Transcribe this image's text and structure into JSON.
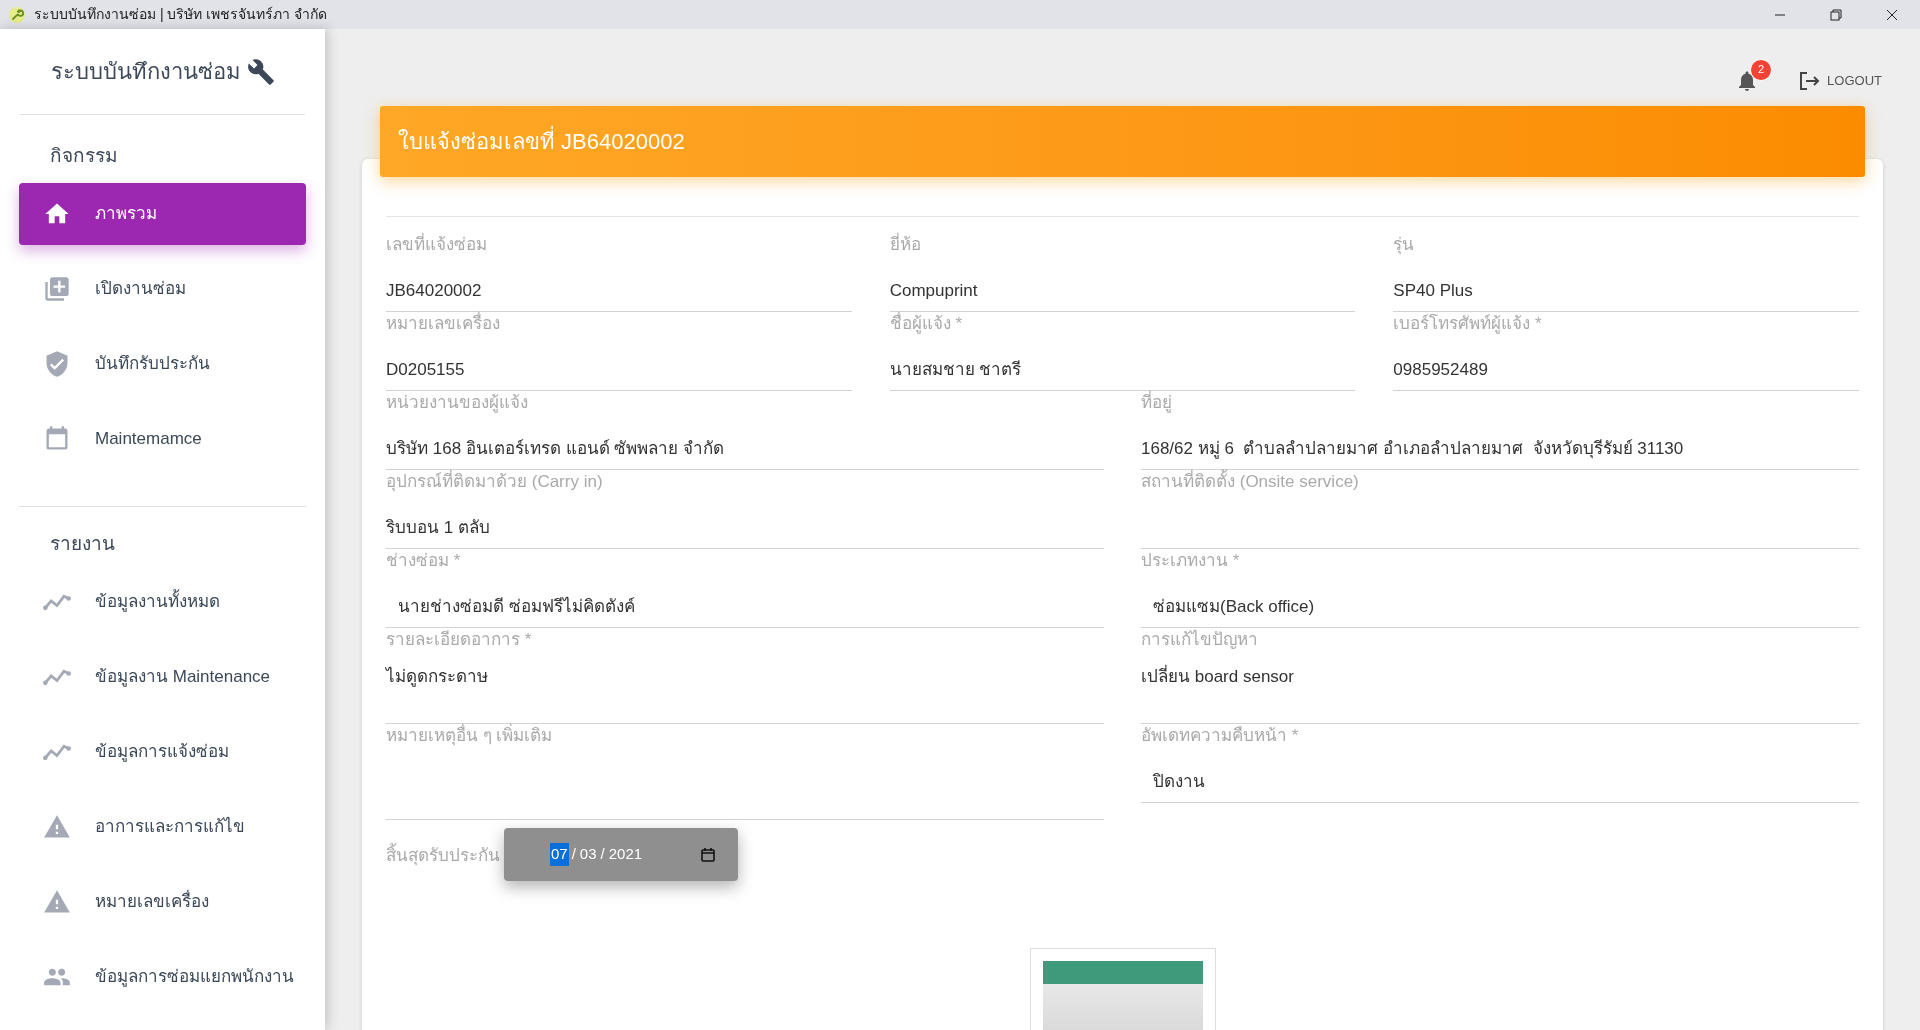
{
  "window": {
    "title": "ระบบบันทึกงานซ่อม | บริษัท เพชรจันทร์ภา จำกัด"
  },
  "sidebar": {
    "title": "ระบบบันทึกงานซ่อม",
    "sections": [
      {
        "heading": "กิจกรรม",
        "items": [
          {
            "label": "ภาพรวม",
            "selected": true
          },
          {
            "label": "เปิดงานซ่อม",
            "selected": false
          },
          {
            "label": "บันทึกรับประกัน",
            "selected": false
          },
          {
            "label": "Maintemamce",
            "selected": false
          }
        ]
      },
      {
        "heading": "รายงาน",
        "items": [
          {
            "label": "ข้อมูลงานทั้งหมด",
            "selected": false
          },
          {
            "label": "ข้อมูลงาน Maintenance",
            "selected": false
          },
          {
            "label": "ข้อมูลการแจ้งซ่อม",
            "selected": false
          },
          {
            "label": "อาการและการแก้ไข",
            "selected": false
          },
          {
            "label": "หมายเลขเครื่อง",
            "selected": false
          },
          {
            "label": "ข้อมูลการซ่อมแยกพนักงาน",
            "selected": false
          }
        ]
      }
    ]
  },
  "topbar": {
    "notification_count": "2",
    "logout": "LOGOUT"
  },
  "form": {
    "title": "ใบแจ้งซ่อมเลขที่ JB64020002",
    "rows": [
      {
        "fields": [
          {
            "label": "เลขที่แจ้งซ่อม",
            "value": "JB64020002",
            "kind": "text"
          },
          {
            "label": "ยี่ห้อ",
            "value": "Compuprint",
            "kind": "text"
          },
          {
            "label": "รุ่น",
            "value": "SP40 Plus",
            "kind": "text"
          }
        ]
      },
      {
        "fields": [
          {
            "label": "หมายเลขเครื่อง",
            "value": "D0205155",
            "kind": "text"
          },
          {
            "label": "ชื่อผู้แจ้ง *",
            "value": "นายสมชาย ชาตรี",
            "kind": "text"
          },
          {
            "label": "เบอร์โทรศัพท์ผู้แจ้ง *",
            "value": "0985952489",
            "kind": "text"
          }
        ]
      },
      {
        "fields": [
          {
            "label": "หน่วยงานของผู้แจ้ง",
            "value": "บริษัท 168 อินเตอร์เทรด แอนด์ ซัพพลาย จำกัด",
            "kind": "text"
          },
          {
            "label": "ที่อยู่",
            "value": "168/62 หมู่ 6  ตำบลลำปลายมาศ อำเภอลำปลายมาศ  จังหวัดบุรีรัมย์ 31130",
            "kind": "text"
          }
        ]
      },
      {
        "fields": [
          {
            "label": "อุปกรณ์ที่ติดมาด้วย (Carry in)",
            "value": "ริบบอน 1 ตลับ",
            "kind": "text"
          },
          {
            "label": "สถานที่ติดตั้ง (Onsite service)",
            "kind": "text"
          }
        ]
      },
      {
        "fields": [
          {
            "label": "ช่างซ่อม *",
            "value": "นายช่างซ่อมดี ซ่อมฟรีไม่คิดตังค์",
            "kind": "select"
          },
          {
            "label": "ประเภทงาน *",
            "value": "ซ่อมแซม(Back office)",
            "kind": "select"
          }
        ]
      },
      {
        "fields": [
          {
            "label": "รายละเอียดอาการ *",
            "value": "ไม่ดูดกระดาษ",
            "kind": "textarea"
          },
          {
            "label": "การแก้ไขปัญหา",
            "value": "เปลี่ยน board sensor",
            "kind": "textarea"
          }
        ]
      },
      {
        "fields": [
          {
            "label": "หมายเหตุอื่น ๆ เพิ่มเติม",
            "kind": "textarea"
          },
          {
            "label": "อัพเดทความคืบหน้า *",
            "value": "ปิดงาน",
            "kind": "select"
          }
        ]
      }
    ],
    "warranty": {
      "label": "สิ้นสุดรับประกัน",
      "separator": "/",
      "segments": [
        {
          "text": "07",
          "selected": true
        },
        {
          "text": "03",
          "selected": false
        },
        {
          "text": "2021",
          "selected": false
        }
      ]
    }
  }
}
